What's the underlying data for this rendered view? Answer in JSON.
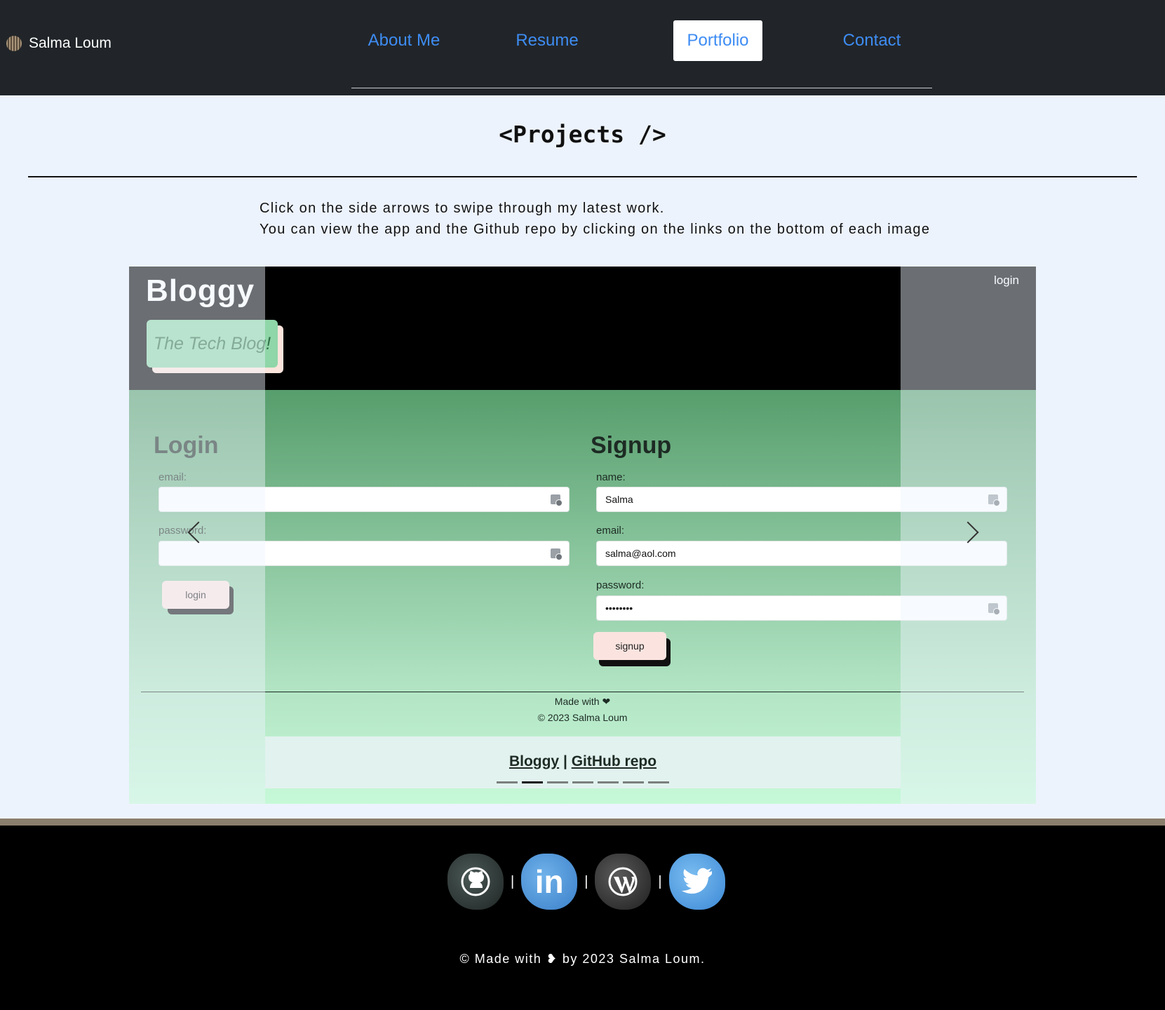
{
  "brand": {
    "name": "Salma Loum"
  },
  "nav": {
    "links": [
      {
        "label": "About Me",
        "active": false
      },
      {
        "label": "Resume",
        "active": false
      },
      {
        "label": "Portfolio",
        "active": true
      },
      {
        "label": "Contact",
        "active": false
      }
    ]
  },
  "projects": {
    "title": "<Projects />",
    "intro_line1": "Click on the side arrows to swipe through my latest work.",
    "intro_line2": "You can view the app and the Github repo by clicking on the links on the bottom of each image"
  },
  "slide": {
    "app_title": "Bloggy",
    "tagline": "The Tech Blog!",
    "header_login": "login",
    "login": {
      "title": "Login",
      "email_label": "email:",
      "email_value": "",
      "password_label": "password:",
      "password_value": "",
      "button": "login"
    },
    "signup": {
      "title": "Signup",
      "name_label": "name:",
      "name_value": "Salma",
      "email_label": "email:",
      "email_value": "salma@aol.com",
      "password_label": "password:",
      "password_value": "••••••••",
      "button": "signup"
    },
    "footer_made": "Made with ❤",
    "footer_copy": "© 2023 Salma Loum",
    "app_link": "Bloggy",
    "link_separator": "|",
    "repo_link": "GitHub repo",
    "active_index": 1,
    "slide_count": 7
  },
  "footer": {
    "socials": [
      {
        "name": "github",
        "icon": "github-icon"
      },
      {
        "name": "linkedin",
        "icon": "linkedin-icon"
      },
      {
        "name": "wordpress",
        "icon": "wordpress-icon"
      },
      {
        "name": "twitter",
        "icon": "twitter-icon"
      }
    ],
    "separator": "|",
    "linkedin_text": "in",
    "copyright": "© Made with ❥ by 2023 Salma Loum."
  },
  "colors": {
    "nav_bg": "#212529",
    "nav_link": "#3e8cf3",
    "page_bg": "#edf3fd",
    "footer_bg": "#000000"
  }
}
